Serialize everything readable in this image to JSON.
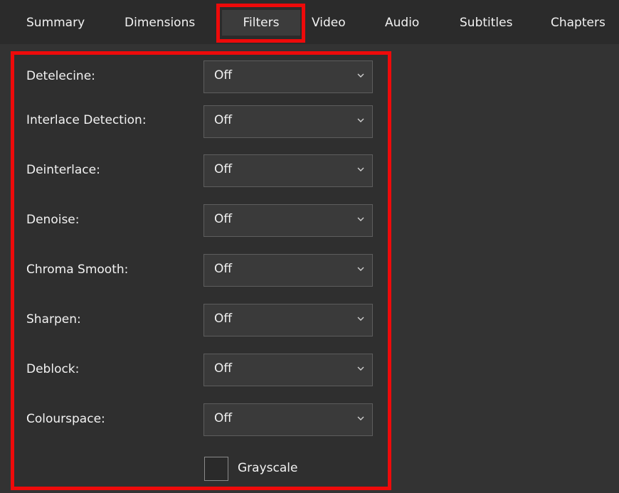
{
  "tabs": [
    {
      "label": "Summary",
      "active": false
    },
    {
      "label": "Dimensions",
      "active": false
    },
    {
      "label": "Filters",
      "active": true
    },
    {
      "label": "Video",
      "active": false
    },
    {
      "label": "Audio",
      "active": false
    },
    {
      "label": "Subtitles",
      "active": false
    },
    {
      "label": "Chapters",
      "active": false
    }
  ],
  "filters": [
    {
      "label": "Detelecine:",
      "value": "Off"
    },
    {
      "label": "Interlace Detection:",
      "value": "Off"
    },
    {
      "label": "Deinterlace:",
      "value": "Off"
    },
    {
      "label": "Denoise:",
      "value": "Off"
    },
    {
      "label": "Chroma Smooth:",
      "value": "Off"
    },
    {
      "label": "Sharpen:",
      "value": "Off"
    },
    {
      "label": "Deblock:",
      "value": "Off"
    },
    {
      "label": "Colourspace:",
      "value": "Off"
    }
  ],
  "grayscale": {
    "label": "Grayscale",
    "checked": false
  },
  "colors": {
    "background": "#333333",
    "tabbar": "#2b2b2b",
    "panel": "#2f2f2f",
    "select": "#3a3a3a",
    "highlight": "#ee0a0a"
  }
}
